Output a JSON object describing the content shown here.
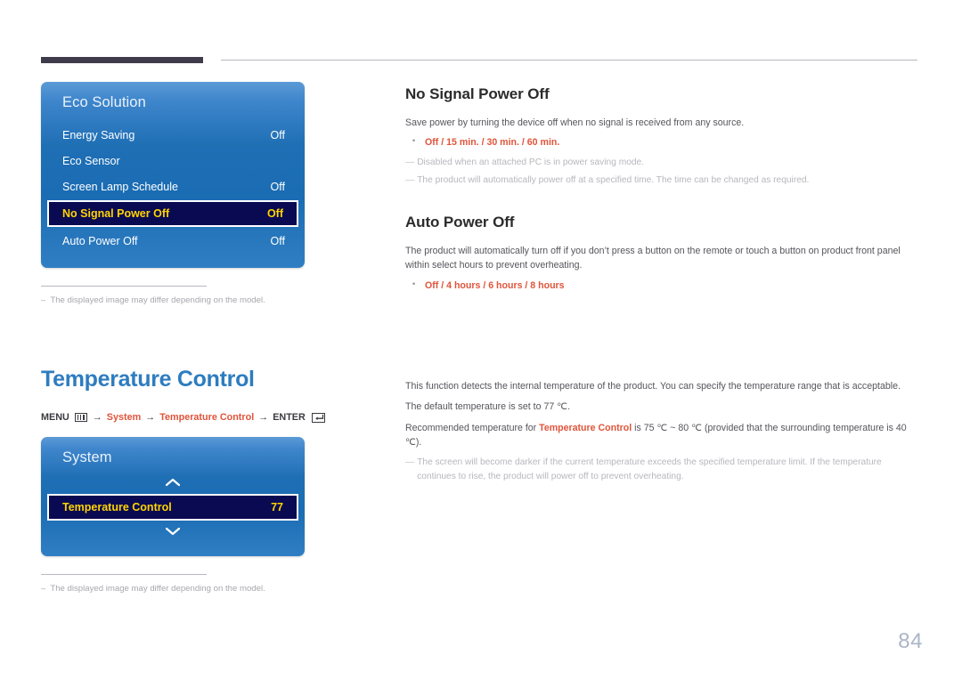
{
  "page": {
    "number": "84"
  },
  "sections": [
    {
      "osd": {
        "title": "Eco Solution",
        "rows": [
          {
            "label": "Energy Saving",
            "value": "Off",
            "selected": false
          },
          {
            "label": "Eco Sensor",
            "value": "",
            "selected": false
          },
          {
            "label": "Screen Lamp Schedule",
            "value": "Off",
            "selected": false
          },
          {
            "label": "No Signal Power Off",
            "value": "Off",
            "selected": true
          },
          {
            "label": "Auto Power Off",
            "value": "Off",
            "selected": false
          }
        ]
      },
      "image_note": {
        "dash": "–",
        "text": "The displayed image may differ depending on the model."
      }
    },
    {
      "big_title": "Temperature Control",
      "breadcrumb": {
        "menu_label": "MENU",
        "menu_icon": "menu-icon",
        "arrow1": "→",
        "item1": "System",
        "arrow2": "→",
        "item2": "Temperature Control",
        "arrow3": "→",
        "enter_label": "ENTER",
        "enter_icon": "enter-icon"
      },
      "osd": {
        "title": "System",
        "scroll_up": "scroll-up-arrow",
        "scroll_down": "scroll-down-arrow",
        "rows": [
          {
            "label": "Temperature Control",
            "value": "77",
            "selected": true
          }
        ]
      },
      "image_note": {
        "dash": "–",
        "text": "The displayed image may differ depending on the model."
      }
    }
  ],
  "right": {
    "no_signal": {
      "heading": "No Signal Power Off",
      "paragraph": "Save power by turning the device off when no signal is received from any source.",
      "options": {
        "first": "Off",
        "rest": " / 15 min. / 30 min. / 60 min."
      },
      "notes": [
        {
          "dash": "—",
          "text": "Disabled when an attached PC is in power saving mode."
        },
        {
          "dash": "—",
          "text": "The product will automatically power off at a specified time. The time can be changed as required."
        }
      ]
    },
    "auto_power": {
      "heading": "Auto Power Off",
      "paragraph": "The product will automatically turn off if you don’t press a button on the remote or touch a button on product front panel within select hours to prevent overheating.",
      "options": {
        "first": "Off",
        "rest": " / 4 hours / 6 hours / 8 hours"
      }
    },
    "temperature": {
      "paragraph1": "This function detects the internal temperature of the product. You can specify the temperature range that is acceptable.",
      "paragraph2": "The default temperature is set to 77 ℃.",
      "paragraph3_pre": "Recommended temperature for ",
      "paragraph3_hl": "Temperature Control",
      "paragraph3_post": " is 75 ℃ ~ 80 ℃ (provided that the surrounding temperature is 40 ℃).",
      "note": {
        "dash": "—",
        "text": "The screen will become darker if the current temperature exceeds the specified temperature limit. If the temperature continues to rise, the product will power off to prevent overheating."
      }
    }
  }
}
